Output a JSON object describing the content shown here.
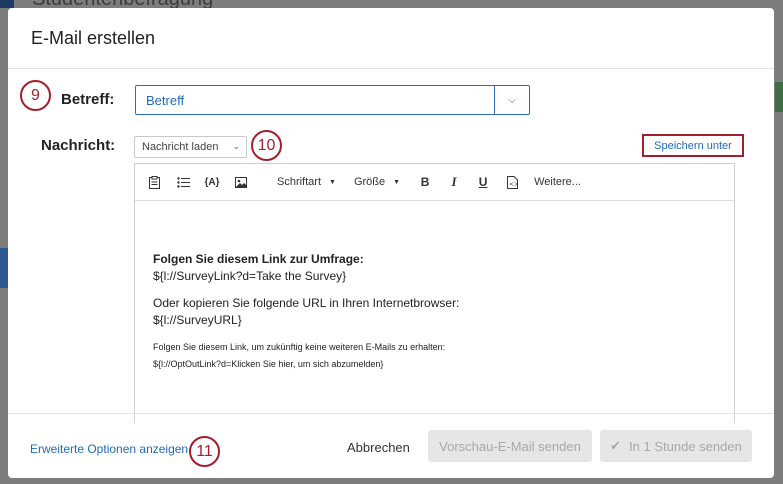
{
  "background": {
    "title": "Studentenbefragung"
  },
  "modal": {
    "title": "E-Mail erstellen"
  },
  "annotations": {
    "subject": "9",
    "load_message": "10",
    "advanced": "11"
  },
  "subject": {
    "label": "Betreff:",
    "value": "Betreff"
  },
  "message": {
    "label": "Nachricht:",
    "load_label": "Nachricht laden",
    "save_as_label": "Speichern unter"
  },
  "toolbar": {
    "font_label": "Schriftart",
    "size_label": "Größe",
    "bold": "B",
    "italic": "I",
    "underline": "U",
    "more_label": "Weitere..."
  },
  "editor": {
    "heading": "Folgen Sie diesem Link zur Umfrage:",
    "survey_link": "${l://SurveyLink?d=Take the Survey}",
    "copy_text": "Oder kopieren Sie folgende URL in Ihren Internetbrowser:",
    "survey_url": "${l://SurveyURL}",
    "optout_text": "Folgen Sie diesem Link, um zukünftig keine weiteren E-Mails zu erhalten:",
    "optout_link": "${l://OptOutLink?d=Klicken Sie hier, um sich abzumelden}"
  },
  "footer": {
    "advanced_label": "Erweiterte Optionen anzeigen",
    "cancel_label": "Abbrechen",
    "preview_label": "Vorschau-E-Mail senden",
    "send_label": "In 1 Stunde senden"
  }
}
